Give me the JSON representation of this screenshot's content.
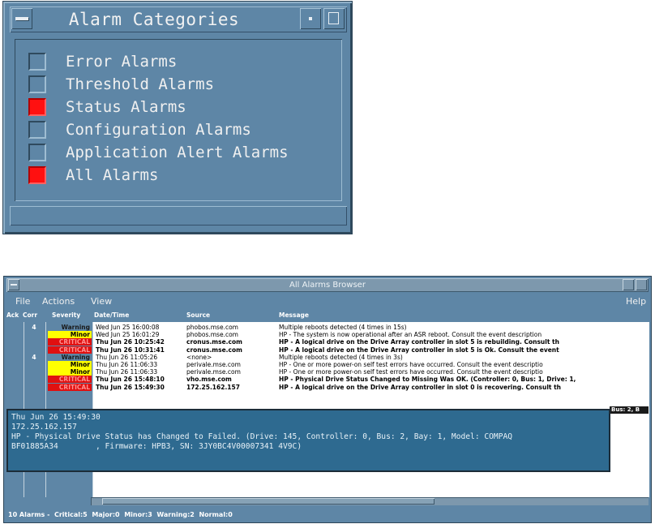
{
  "categories_window": {
    "title": "Alarm Categories",
    "items": [
      {
        "label": "Error Alarms",
        "checked": false
      },
      {
        "label": "Threshold Alarms",
        "checked": false
      },
      {
        "label": "Status Alarms",
        "checked": true
      },
      {
        "label": "Configuration Alarms",
        "checked": false
      },
      {
        "label": "Application Alert Alarms",
        "checked": false
      },
      {
        "label": "All Alarms",
        "checked": true
      }
    ]
  },
  "browser_window": {
    "title": "All Alarms Browser",
    "menu": {
      "file": "File",
      "actions": "Actions",
      "view": "View",
      "help": "Help"
    },
    "columns": {
      "ack": "Ack",
      "corr": "Corr",
      "severity": "Severity",
      "datetime": "Date/Time",
      "source": "Source",
      "message": "Message"
    },
    "rows": [
      {
        "corr": "4",
        "severity": "Warning",
        "sev_class": "warning",
        "date": "Wed Jun 25 16:00:08",
        "source": "phobos.mse.com",
        "message": "Multiple reboots detected (4 times in 15s)",
        "bold": false
      },
      {
        "corr": "",
        "severity": "Minor",
        "sev_class": "minor",
        "date": "Wed Jun 25 16:01:29",
        "source": "phobos.mse.com",
        "message": "HP - The system is now operational after an ASR reboot.  Consult the event description",
        "bold": false
      },
      {
        "corr": "",
        "severity": "CRITICAL",
        "sev_class": "critical",
        "date": "Thu Jun 26 10:25:42",
        "source": "cronus.mse.com",
        "message": "HP - A logical drive on the Drive Array controller in slot 5 is rebuilding.  Consult th",
        "bold": true
      },
      {
        "corr": "",
        "severity": "CRITICAL",
        "sev_class": "critical",
        "date": "Thu Jun 26 10:31:41",
        "source": "cronus.mse.com",
        "message": "HP - A logical drive on the Drive Array controller in slot 5 is Ok.  Consult the event",
        "bold": true
      },
      {
        "corr": "4",
        "severity": "Warning",
        "sev_class": "warning",
        "date": "Thu Jun 26 11:05:26",
        "source": "<none>",
        "message": "Multiple reboots detected (4 times in 3s)",
        "bold": false
      },
      {
        "corr": "",
        "severity": "Minor",
        "sev_class": "minor",
        "date": "Thu Jun 26 11:06:33",
        "source": "perivale.mse.com",
        "message": "HP - One or more power-on self test errors have occurred.  Consult the event descriptio",
        "bold": false
      },
      {
        "corr": "",
        "severity": "Minor",
        "sev_class": "minor",
        "date": "Thu Jun 26 11:06:33",
        "source": "perivale.mse.com",
        "message": "HP - One or more power-on self test errors have occurred.  Consult the event descriptio",
        "bold": false
      },
      {
        "corr": "",
        "severity": "CRITICAL",
        "sev_class": "critical",
        "date": "Thu Jun 26 15:48:10",
        "source": "vho.mse.com",
        "message": "HP - Physical Drive Status Changed to Missing Was OK. (Controller: 0, Bus: 1, Drive: 1,",
        "bold": true
      },
      {
        "corr": "",
        "severity": "CRITICAL",
        "sev_class": "critical",
        "date": "Thu Jun 26 15:49:30",
        "source": "172.25.162.157",
        "message": "HP - A logical drive on the Drive Array controller in slot 0 is recovering.  Consult th",
        "bold": true
      }
    ],
    "tooltip": {
      "line1": "Thu Jun 26 15:49:30",
      "line2": "172.25.162.157",
      "line3": "HP - Physical Drive Status has Changed to Failed. (Drive: 145, Controller: 0, Bus: 2, Bay: 1, Model: COMPAQ",
      "line4": "BF01885A34        , Firmware: HPB3, SN: 3JY0BC4V00007341 4V9C)",
      "tail": "Bus: 2, B"
    },
    "status": "10 Alarms -  Critical:5  Major:0  Minor:3  Warning:2  Normal:0"
  }
}
